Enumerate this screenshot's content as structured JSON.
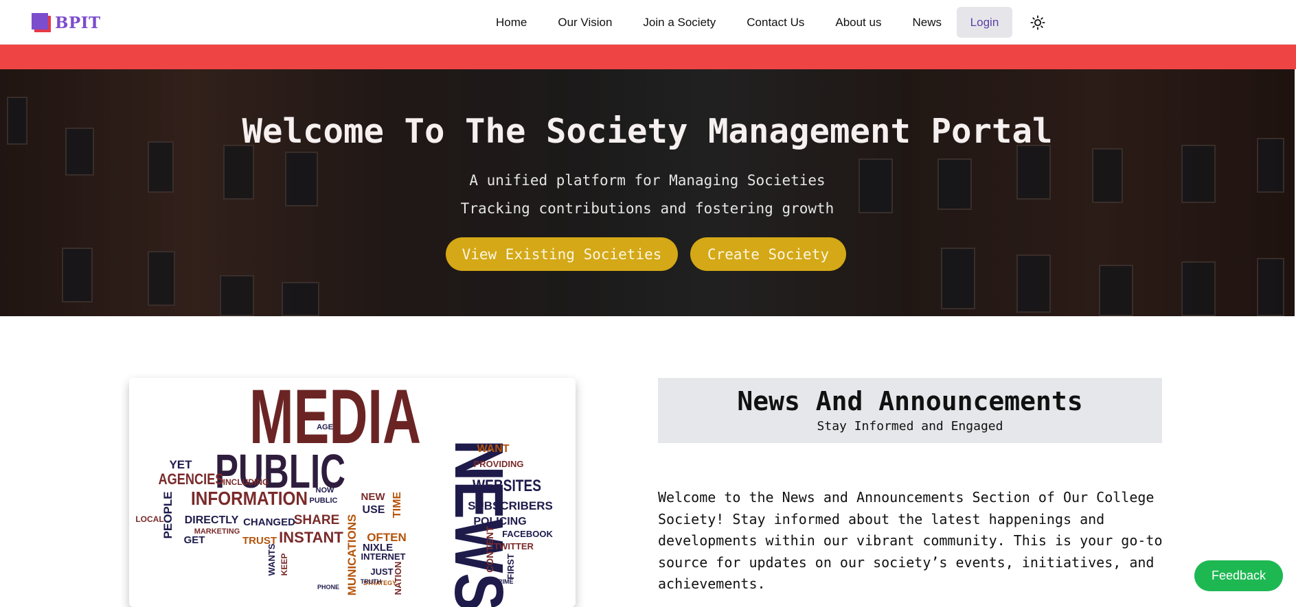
{
  "brand": {
    "name": "BPIT",
    "logo_colors": [
      "#7c4dcc",
      "#e53945"
    ]
  },
  "nav": {
    "links": [
      "Home",
      "Our Vision",
      "Join a Society",
      "Contact Us",
      "About us",
      "News"
    ],
    "login_label": "Login",
    "theme_icon": "sun-icon"
  },
  "colors": {
    "alert_bar": "#ef4444",
    "hero_button": "#d4a816",
    "feedback": "#1eb853",
    "brand": "#7c4dcc"
  },
  "hero": {
    "title": "Welcome To The Society Management Portal",
    "subtitle_line1": "A unified platform for Managing Societies",
    "subtitle_line2": "Tracking contributions and fostering growth",
    "view_button": "View Existing Societies",
    "create_button": "Create Society"
  },
  "media_card": {
    "headline_words": [
      "MEDIA",
      "PUBLIC",
      "NEWS",
      "INFORMATION",
      "WEBSITES",
      "AGENCIES"
    ],
    "small_words": [
      "INSTANT",
      "SHARE",
      "CHANGED",
      "DIRECTLY",
      "POLICING",
      "SUBSCRIBERS",
      "TWITTER",
      "FACEBOOK",
      "INTERNET",
      "OFTEN",
      "TRUST",
      "PEOPLE",
      "NIXLE",
      "USE",
      "NEW",
      "TIME",
      "WANT",
      "PROVIDING",
      "GET",
      "MARKETING",
      "STRATEGY",
      "CONTENT",
      "FIRST",
      "NATION",
      "JUST",
      "KEEP",
      "WANTS",
      "LOCAL",
      "YET",
      "INCLUDING",
      "AGE",
      "NOW",
      "PUBLIC",
      "MUNICATIONS",
      "TRUTH",
      "CRIME",
      "PHONE"
    ]
  },
  "news": {
    "title": "News And Announcements",
    "subtitle": "Stay Informed and Engaged",
    "body": "Welcome to the News and Announcements Section of Our College Society! Stay informed about the latest happenings and developments within our vibrant community. This is your go-to source for updates on our society’s events, initiatives, and achievements."
  },
  "feedback_label": "Feedback"
}
